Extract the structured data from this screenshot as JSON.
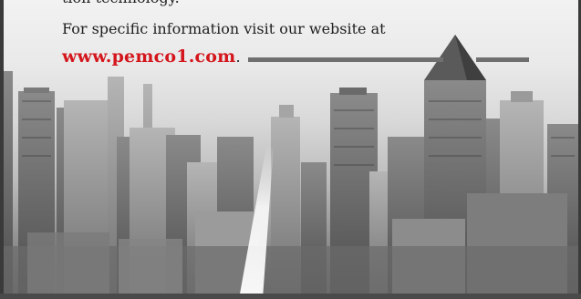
{
  "document": {
    "cut_off_line": "tion technology.",
    "info_text": "For specific information visit our website at",
    "website_url": "www.pemco1.com",
    "url_suffix": ".",
    "colors": {
      "url_red": "#d4161c",
      "text_dark": "#1f1f1f",
      "rule_gray": "#6f6f6f"
    }
  }
}
